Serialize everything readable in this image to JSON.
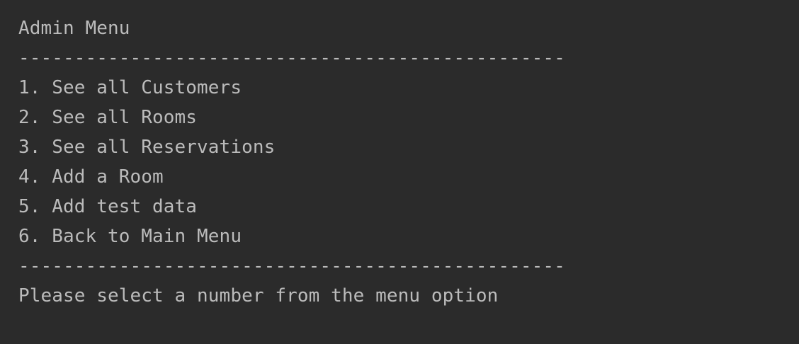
{
  "console": {
    "title": "Admin Menu",
    "separator": "-------------------------------------------------",
    "menu_items": [
      "1. See all Customers",
      "2. See all Rooms",
      "3. See all Reservations",
      "4. Add a Room",
      "5. Add test data",
      "6. Back to Main Menu"
    ],
    "prompt": "Please select a number from the menu option"
  },
  "colors": {
    "background": "#2b2b2b",
    "text": "#bbbbbb"
  }
}
